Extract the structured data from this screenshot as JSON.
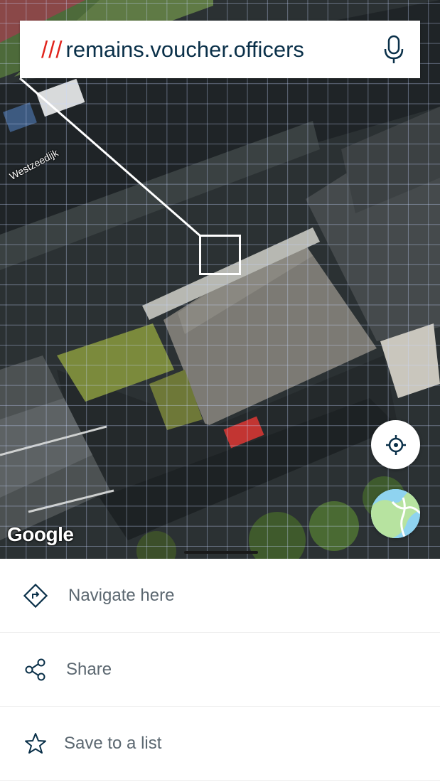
{
  "search": {
    "slashes": "///",
    "address": "remains.voucher.officers"
  },
  "map": {
    "street_label": "Westzeedijk",
    "attribution": "Google",
    "locate_icon": "crosshair-icon",
    "maptype_icon": "map-layer-icon"
  },
  "actions": [
    {
      "label": "Navigate here",
      "icon": "navigate-diamond-icon"
    },
    {
      "label": "Share",
      "icon": "share-icon"
    },
    {
      "label": "Save to a list",
      "icon": "star-icon"
    }
  ],
  "colors": {
    "accent_red": "#e1241c",
    "text_navy": "#0a3049",
    "action_text": "#5b6770"
  }
}
